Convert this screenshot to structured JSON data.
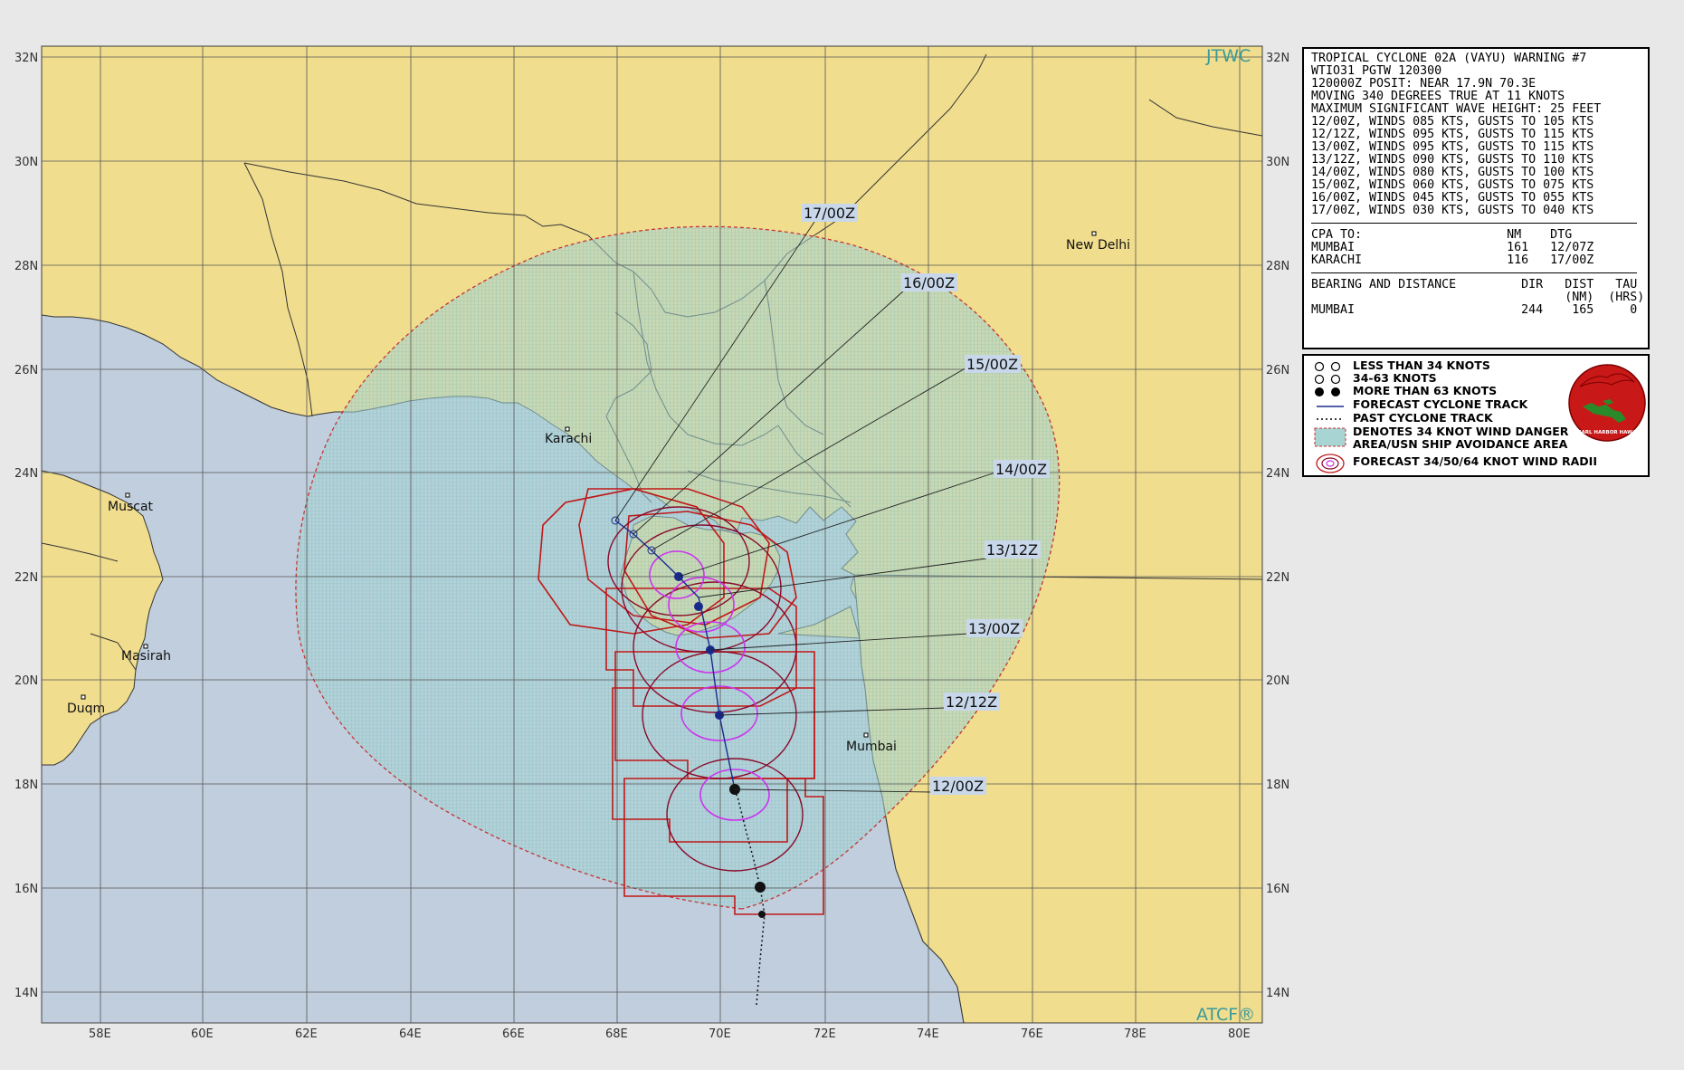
{
  "map": {
    "brand_top": "JTWC",
    "brand_bottom": "ATCF®",
    "lat_labels": [
      "32N",
      "30N",
      "28N",
      "26N",
      "24N",
      "22N",
      "20N",
      "18N",
      "16N",
      "14N"
    ],
    "lon_labels": [
      "58E",
      "60E",
      "62E",
      "64E",
      "66E",
      "68E",
      "70E",
      "72E",
      "74E",
      "76E",
      "78E",
      "80E"
    ],
    "cities": [
      {
        "name": "New Delhi"
      },
      {
        "name": "Karachi"
      },
      {
        "name": "Muscat"
      },
      {
        "name": "Masirah"
      },
      {
        "name": "Duqm"
      },
      {
        "name": "Mumbai"
      }
    ],
    "forecast_labels": [
      "17/00Z",
      "16/00Z",
      "15/00Z",
      "14/00Z",
      "13/12Z",
      "13/00Z",
      "12/12Z",
      "12/00Z"
    ]
  },
  "warning": {
    "lines": [
      "TROPICAL CYCLONE 02A (VAYU) WARNING #7",
      "WTIO31 PGTW 120300",
      "120000Z POSIT: NEAR 17.9N 70.3E",
      "MOVING 340 DEGREES TRUE AT 11 KNOTS",
      "MAXIMUM SIGNIFICANT WAVE HEIGHT: 25 FEET",
      "12/00Z, WINDS 085 KTS, GUSTS TO 105 KTS",
      "12/12Z, WINDS 095 KTS, GUSTS TO 115 KTS",
      "13/00Z, WINDS 095 KTS, GUSTS TO 115 KTS",
      "13/12Z, WINDS 090 KTS, GUSTS TO 110 KTS",
      "14/00Z, WINDS 080 KTS, GUSTS TO 100 KTS",
      "15/00Z, WINDS 060 KTS, GUSTS TO 075 KTS",
      "16/00Z, WINDS 045 KTS, GUSTS TO 055 KTS",
      "17/00Z, WINDS 030 KTS, GUSTS TO 040 KTS"
    ],
    "cpa_header": "CPA TO:                    NM    DTG",
    "cpa_rows": [
      "MUMBAI                     161   12/07Z",
      "KARACHI                    116   17/00Z"
    ],
    "bearing_header": "BEARING AND DISTANCE         DIR   DIST   TAU",
    "bearing_units": "                                   (NM)  (HRS)",
    "bearing_rows": [
      "MUMBAI                       244    165     0"
    ]
  },
  "legend": {
    "items": [
      "LESS THAN 34 KNOTS",
      "34-63 KNOTS",
      "MORE THAN 63 KNOTS",
      "FORECAST CYCLONE TRACK",
      "PAST CYCLONE  TRACK",
      "DENOTES 34 KNOT WIND DANGER",
      "AREA/USN SHIP AVOIDANCE AREA",
      "FORECAST 34/50/64 KNOT WIND RADII"
    ],
    "seal_text": "JOINT TYPHOON WARNING CENTER",
    "seal_subtext": "PEARL HARBOR HAWAII"
  },
  "colors": {
    "land": "#f0dd8e",
    "sea": "#c0cedd",
    "danger_area": "#a8d4d4",
    "wind_34": "#c01818",
    "wind_50": "#8a0a2a",
    "wind_64": "#cc33ee",
    "track": "#1a2a8a"
  }
}
